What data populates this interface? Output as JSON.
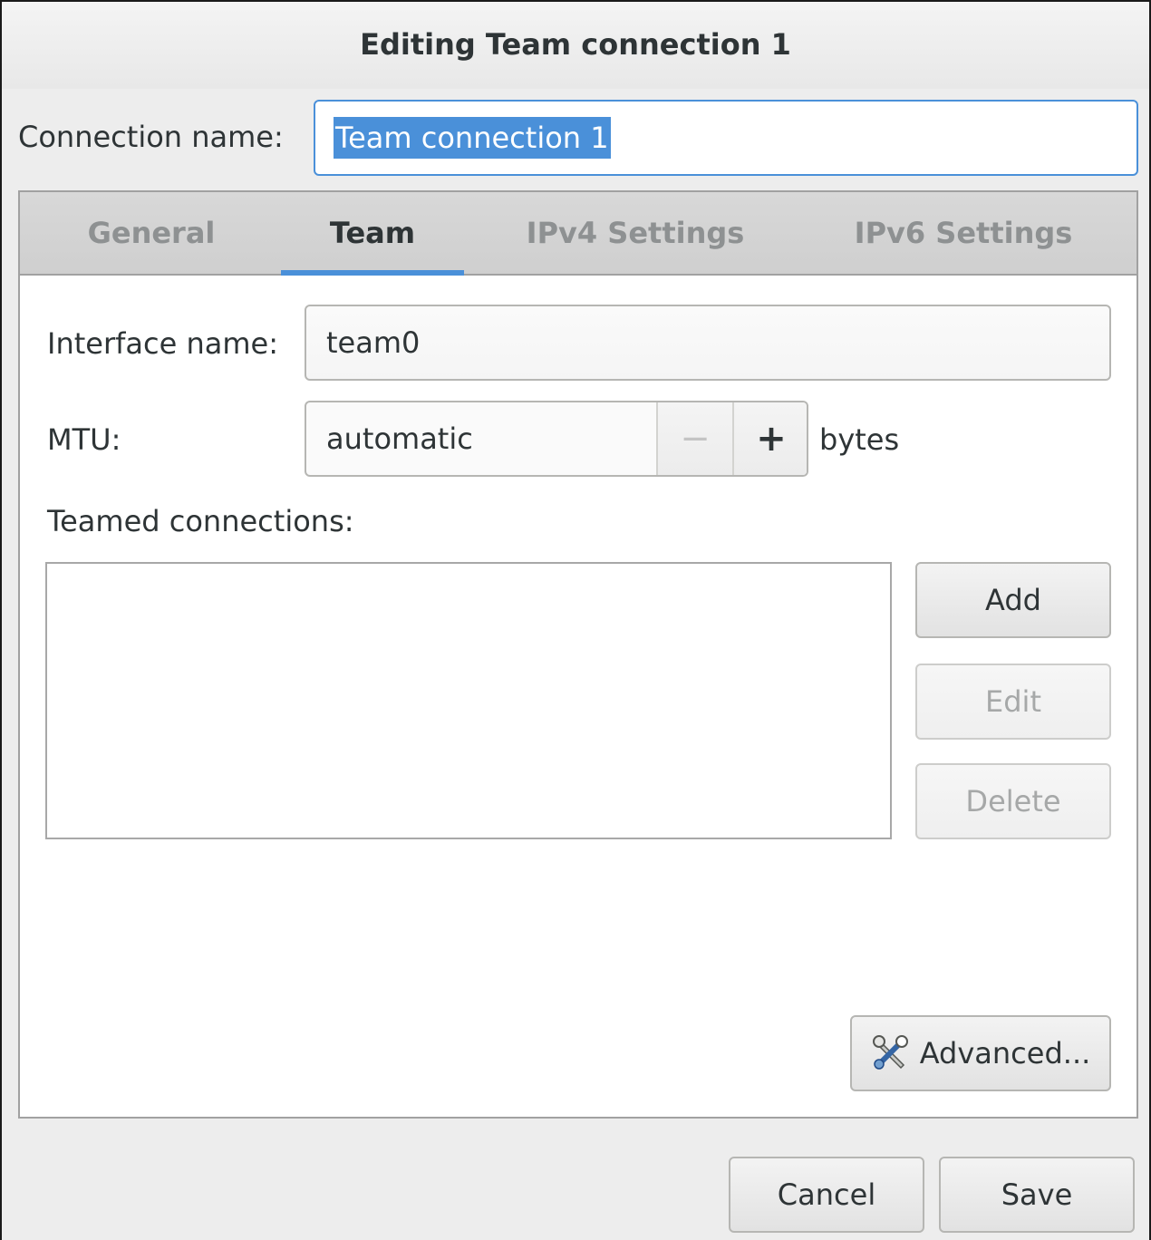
{
  "window": {
    "title": "Editing Team connection 1"
  },
  "connection_name": {
    "label": "Connection name:",
    "value": "Team connection 1"
  },
  "tabs": [
    {
      "label": "General",
      "active": false
    },
    {
      "label": "Team",
      "active": true
    },
    {
      "label": "IPv4 Settings",
      "active": false
    },
    {
      "label": "IPv6 Settings",
      "active": false
    }
  ],
  "team": {
    "interface_label": "Interface name:",
    "interface_value": "team0",
    "mtu_label": "MTU:",
    "mtu_value": "automatic",
    "mtu_decrement": "−",
    "mtu_increment": "+",
    "mtu_unit": "bytes",
    "teamed_label": "Teamed connections:",
    "add_label": "Add",
    "edit_label": "Edit",
    "delete_label": "Delete",
    "advanced_label": "Advanced..."
  },
  "footer": {
    "cancel_label": "Cancel",
    "save_label": "Save"
  },
  "icons": {
    "advanced": "tools-icon"
  },
  "colors": {
    "accent": "#4a90d9"
  }
}
